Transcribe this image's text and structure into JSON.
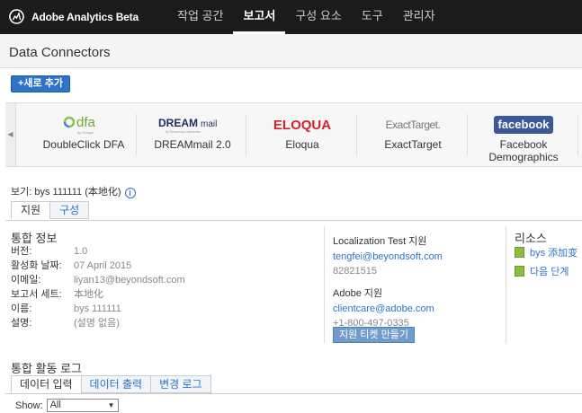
{
  "app": {
    "title": "Adobe Analytics Beta"
  },
  "nav": [
    {
      "label": "작업 공간",
      "active": false
    },
    {
      "label": "보고서",
      "active": true
    },
    {
      "label": "구성 요소",
      "active": false
    },
    {
      "label": "도구",
      "active": false
    },
    {
      "label": "관리자",
      "active": false
    }
  ],
  "page": {
    "title": "Data Connectors",
    "add_button": "+새로 추가"
  },
  "connectors": [
    {
      "name": "DoubleClick DFA",
      "logo_icon": "dfa-logo"
    },
    {
      "name": "DREAMmail 2.0",
      "logo_icon": "dreammail-logo"
    },
    {
      "name": "Eloqua",
      "logo_icon": "eloqua-logo"
    },
    {
      "name": "ExactTarget",
      "logo_icon": "exacttarget-logo"
    },
    {
      "name": "Facebook Demographics",
      "logo_icon": "facebook-logo"
    }
  ],
  "logos": {
    "dfa_text": "dfa",
    "dfa_sub": "by Google",
    "dreammail_a": "DREAM",
    "dreammail_b": "mail",
    "dreammail_sub": "by Responsys Interactive",
    "eloqua_text": "ELOQUA",
    "exacttarget_text": "ExactTarget.",
    "facebook_text": "facebook"
  },
  "view": {
    "label": "보기: bys 111111 (本地化)"
  },
  "subtabs": [
    {
      "label": "지원",
      "active": true
    },
    {
      "label": "구성",
      "active": false
    }
  ],
  "integration": {
    "title": "통합 정보",
    "rows": [
      {
        "key": "버전:",
        "value": "1.0"
      },
      {
        "key": "활성화 날짜:",
        "value": "07 April 2015"
      },
      {
        "key": "이메일:",
        "value": "liyan13@beyondsoft.com"
      },
      {
        "key": "보고서 세트:",
        "value": "本地化"
      },
      {
        "key": "이름:",
        "value": "bys 111111"
      },
      {
        "key": "설명:",
        "value": "(설명 없음)"
      }
    ]
  },
  "support": {
    "loc_heading": "Localization Test 지원",
    "loc_email": "tengfei@beyondsoft.com",
    "loc_phone": "82821515",
    "adobe_heading": "Adobe 지원",
    "adobe_email": "clientcare@adobe.com",
    "adobe_phone": "+1-800-497-0335",
    "ticket_button": "지원 티켓 만들기"
  },
  "resources": {
    "title": "리소스",
    "items": [
      {
        "label": "bys 添加变"
      },
      {
        "label": "다음 단계"
      }
    ]
  },
  "activity_log": {
    "title": "통합 활동 로그",
    "tabs": [
      {
        "label": "데이터 입력",
        "active": true
      },
      {
        "label": "데이터 출력",
        "active": false
      },
      {
        "label": "변경 로그",
        "active": false
      }
    ],
    "show_label": "Show:",
    "show_value": "All"
  },
  "colors": {
    "nav_bg": "#1b1b1b",
    "link": "#2d73c8",
    "eloqua_red": "#d4202c",
    "facebook_blue": "#3b5998"
  }
}
